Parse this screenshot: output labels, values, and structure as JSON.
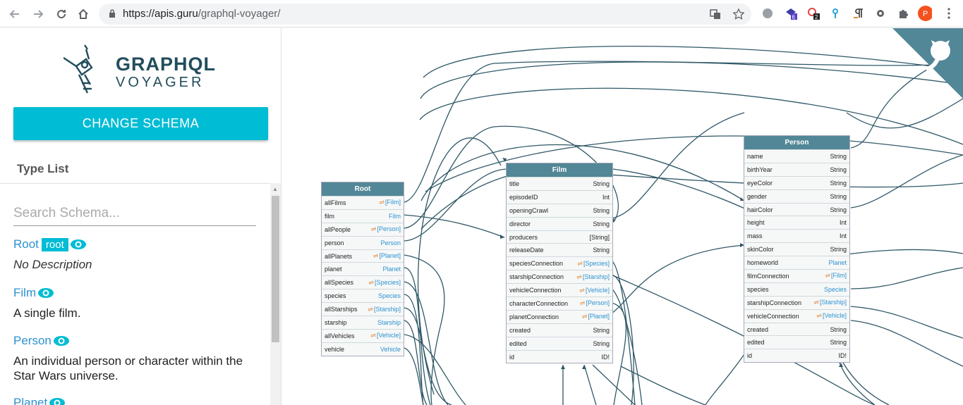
{
  "browser": {
    "url_host": "https://apis.guru",
    "url_path": "/graphql-voyager/",
    "extensions": {
      "badge1": "6",
      "badge2": "2",
      "profile_initial": "P"
    }
  },
  "sidebar": {
    "logo_title": "GRAPHQL",
    "logo_subtitle": "VOYAGER",
    "change_schema": "CHANGE SCHEMA",
    "type_list_title": "Type List",
    "search_placeholder": "Search Schema...",
    "types": [
      {
        "name": "Root",
        "badge": "root",
        "description": "No Description",
        "italic": true
      },
      {
        "name": "Film",
        "description": "A single film."
      },
      {
        "name": "Person",
        "description": "An individual person or character within the Star Wars universe."
      },
      {
        "name": "Planet"
      }
    ]
  },
  "graph": {
    "root": {
      "title": "Root",
      "rows": [
        {
          "field": "allFilms",
          "type": "[Film]",
          "rel": true
        },
        {
          "field": "film",
          "type": "Film"
        },
        {
          "field": "allPeople",
          "type": "[Person]",
          "rel": true
        },
        {
          "field": "person",
          "type": "Person"
        },
        {
          "field": "allPlanets",
          "type": "[Planet]",
          "rel": true
        },
        {
          "field": "planet",
          "type": "Planet"
        },
        {
          "field": "allSpecies",
          "type": "[Species]",
          "rel": true
        },
        {
          "field": "species",
          "type": "Species"
        },
        {
          "field": "allStarships",
          "type": "[Starship]",
          "rel": true
        },
        {
          "field": "starship",
          "type": "Starship"
        },
        {
          "field": "allVehicles",
          "type": "[Vehicle]",
          "rel": true
        },
        {
          "field": "vehicle",
          "type": "Vehicle"
        }
      ]
    },
    "film": {
      "title": "Film",
      "rows": [
        {
          "field": "title",
          "type": "String"
        },
        {
          "field": "episodeID",
          "type": "Int"
        },
        {
          "field": "openingCrawl",
          "type": "String"
        },
        {
          "field": "director",
          "type": "String"
        },
        {
          "field": "producers",
          "type": "[String]"
        },
        {
          "field": "releaseDate",
          "type": "String"
        },
        {
          "field": "speciesConnection",
          "type": "[Species]",
          "rel": true
        },
        {
          "field": "starshipConnection",
          "type": "[Starship]",
          "rel": true
        },
        {
          "field": "vehicleConnection",
          "type": "[Vehicle]",
          "rel": true
        },
        {
          "field": "characterConnection",
          "type": "[Person]",
          "rel": true
        },
        {
          "field": "planetConnection",
          "type": "[Planet]",
          "rel": true
        },
        {
          "field": "created",
          "type": "String"
        },
        {
          "field": "edited",
          "type": "String"
        },
        {
          "field": "id",
          "type": "ID!"
        }
      ]
    },
    "person": {
      "title": "Person",
      "rows": [
        {
          "field": "name",
          "type": "String"
        },
        {
          "field": "birthYear",
          "type": "String"
        },
        {
          "field": "eyeColor",
          "type": "String"
        },
        {
          "field": "gender",
          "type": "String"
        },
        {
          "field": "hairColor",
          "type": "String"
        },
        {
          "field": "height",
          "type": "Int"
        },
        {
          "field": "mass",
          "type": "Int"
        },
        {
          "field": "skinColor",
          "type": "String"
        },
        {
          "field": "homeworld",
          "type": "Planet"
        },
        {
          "field": "filmConnection",
          "type": "[Film]",
          "rel": true
        },
        {
          "field": "species",
          "type": "Species"
        },
        {
          "field": "starshipConnection",
          "type": "[Starship]",
          "rel": true
        },
        {
          "field": "vehicleConnection",
          "type": "[Vehicle]",
          "rel": true
        },
        {
          "field": "created",
          "type": "String"
        },
        {
          "field": "edited",
          "type": "String"
        },
        {
          "field": "id",
          "type": "ID!"
        }
      ]
    }
  },
  "colors": {
    "accent": "#00bcd4",
    "node_header": "#528797",
    "link": "#2d91d0",
    "edge": "#2f5866"
  }
}
